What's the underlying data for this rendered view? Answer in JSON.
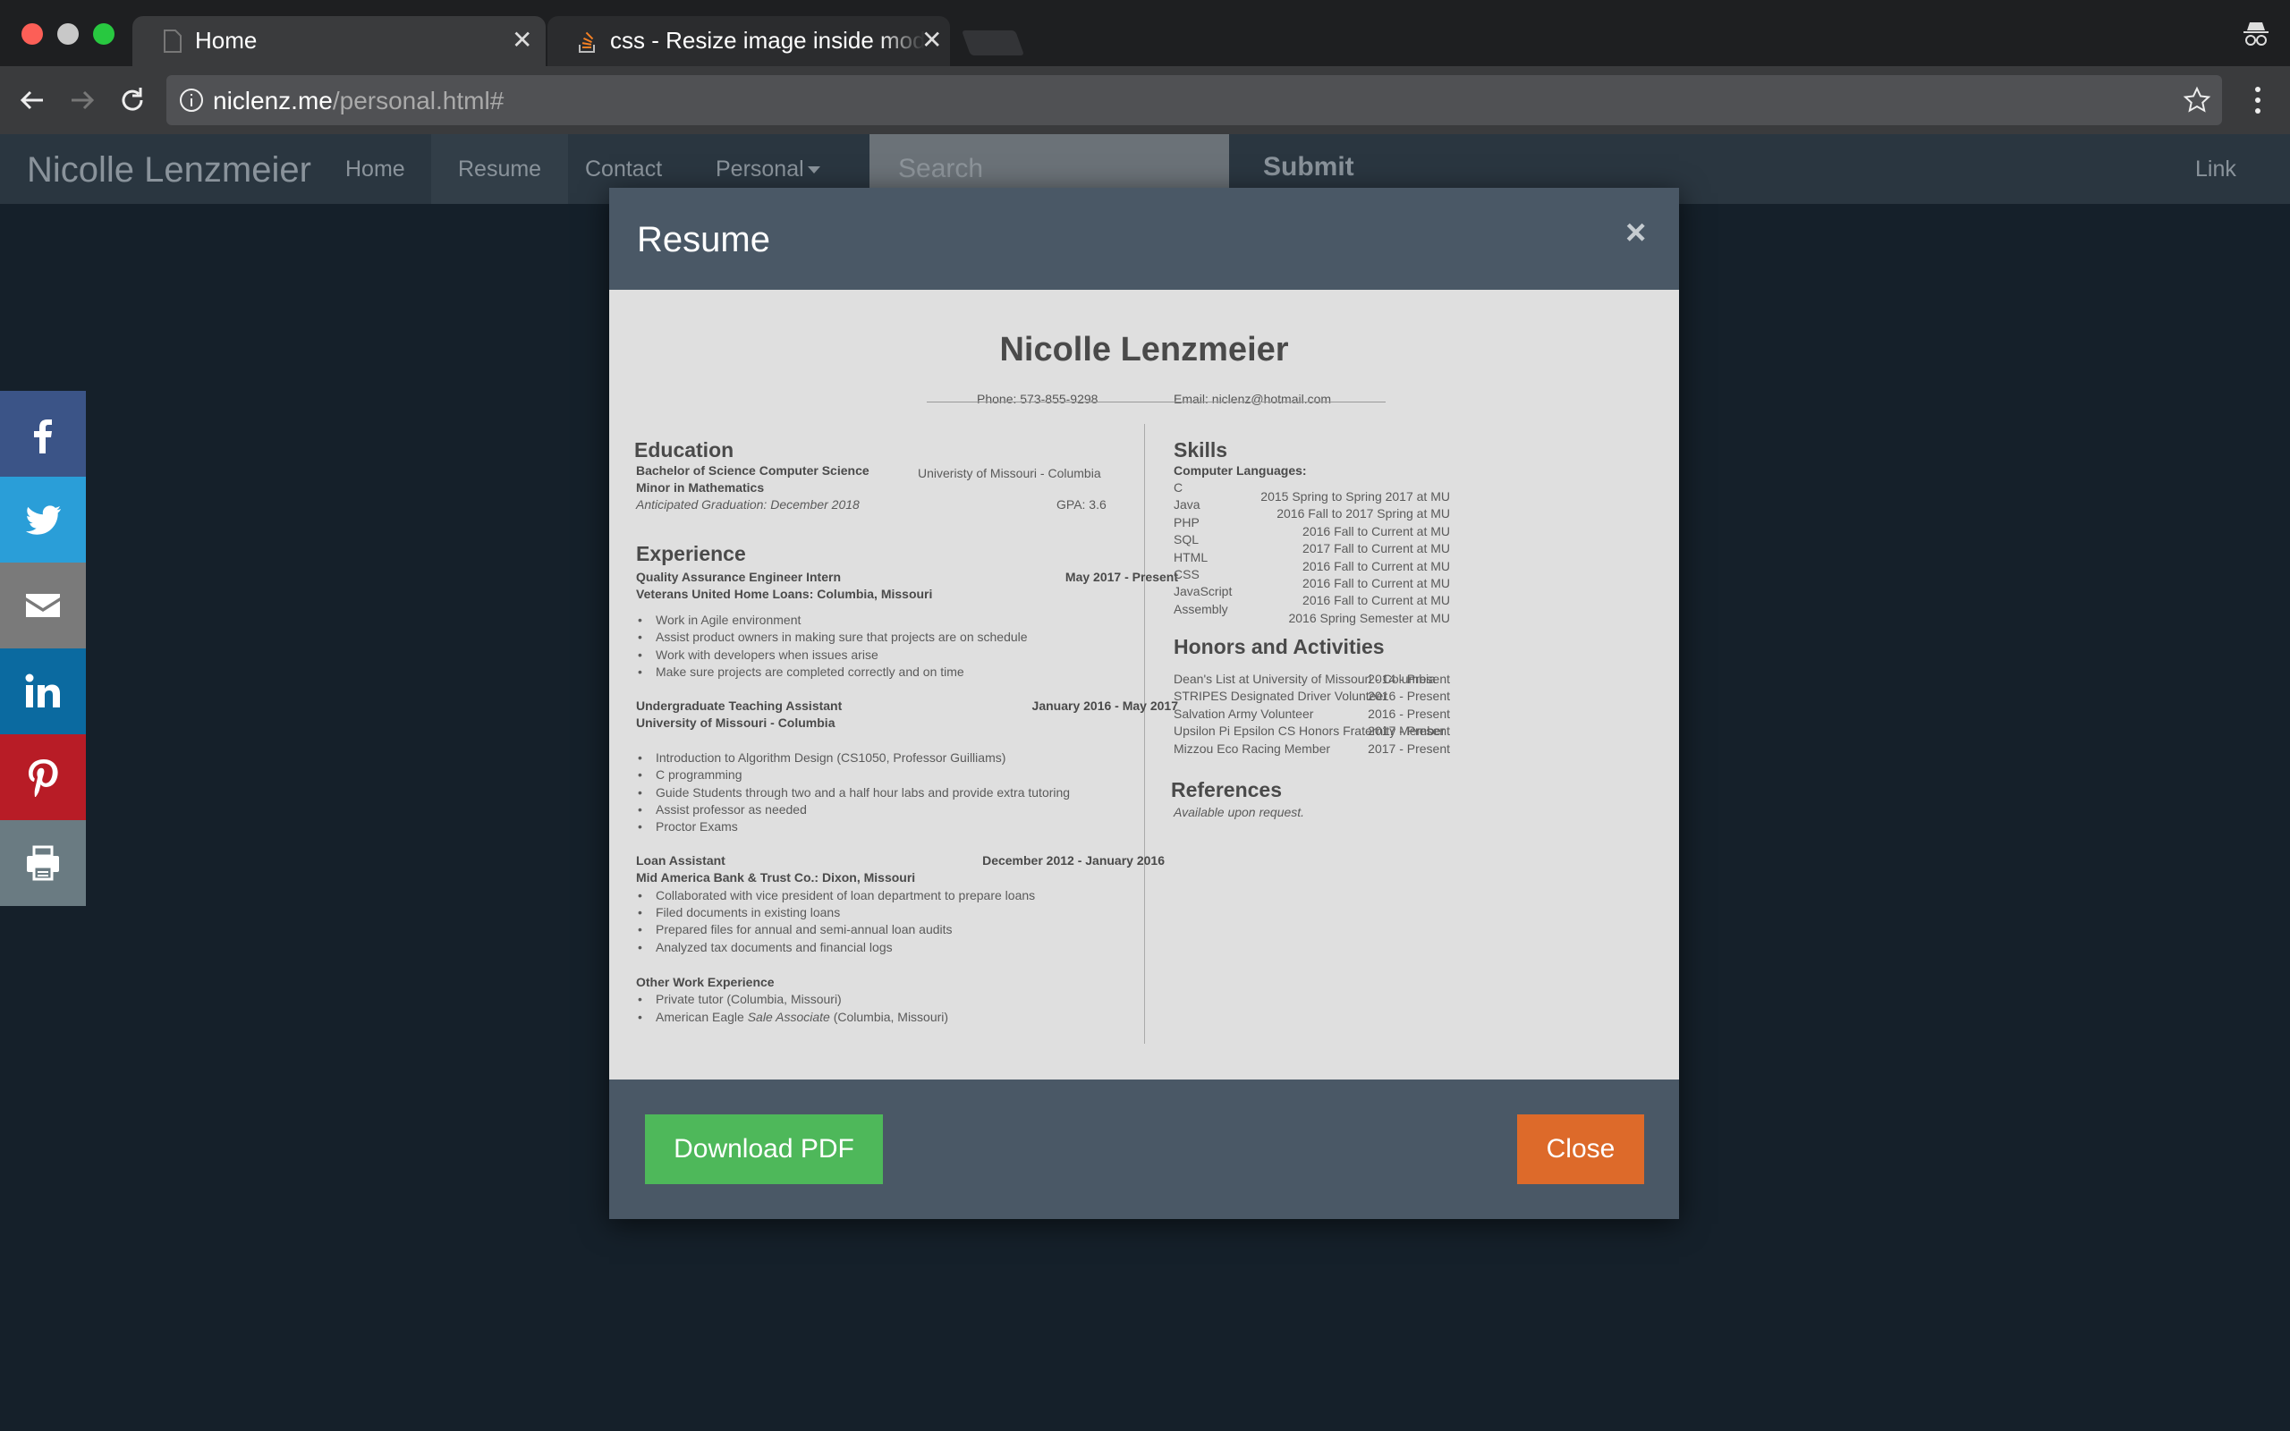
{
  "browser": {
    "tabs": [
      {
        "title": "Home",
        "active": true
      },
      {
        "title": "css - Resize image inside modal",
        "active": false
      }
    ],
    "url_host": "niclenz.me",
    "url_path": "/personal.html#"
  },
  "navbar": {
    "brand": "Nicolle Lenzmeier",
    "links": [
      "Home",
      "Resume",
      "Contact",
      "Personal"
    ],
    "active_link": "Resume",
    "search_placeholder": "Search",
    "submit_label": "Submit",
    "right_link": "Link"
  },
  "share": [
    "facebook-icon",
    "twitter-icon",
    "email-icon",
    "linkedin-icon",
    "pinterest-icon",
    "print-icon"
  ],
  "modal": {
    "title": "Resume",
    "close_x": "×",
    "download_label": "Download PDF",
    "close_label": "Close"
  },
  "resume": {
    "name": "Nicolle Lenzmeier",
    "phone": "Phone: 573-855-9298",
    "email": "Email: niclenz@hotmail.com",
    "education": {
      "heading": "Education",
      "degree": "Bachelor of Science Computer Science",
      "minor": "Minor in Mathematics",
      "school": "Univeristy of Missouri - Columbia",
      "graduation": "Anticipated Graduation: December 2018",
      "gpa": "GPA: 3.6"
    },
    "experience": {
      "heading": "Experience",
      "jobs": [
        {
          "title": "Quality Assurance Engineer Intern",
          "dates": "May 2017 - Present",
          "company": "Veterans United Home Loans: Columbia, Missouri",
          "bullets": [
            "Work in Agile environment",
            "Assist product owners in making sure that projects are on schedule",
            "Work with developers when issues arise",
            "Make sure projects are completed correctly and on time"
          ]
        },
        {
          "title": "Undergraduate Teaching Assistant",
          "dates": "January 2016 - May 2017",
          "company": "University of Missouri - Columbia",
          "bullets": [
            "Introduction to Algorithm Design (CS1050, Professor Guilliams)",
            "C programming",
            "Guide Students through two and a half hour labs and provide extra tutoring",
            "Assist professor as needed",
            "Proctor Exams"
          ]
        },
        {
          "title": "Loan Assistant",
          "dates": "December 2012 - January 2016",
          "company": "Mid America Bank & Trust Co.: Dixon, Missouri",
          "bullets": [
            "Collaborated with vice president of loan department to prepare loans",
            "Filed documents in existing loans",
            "Prepared files for annual and semi-annual loan audits",
            "Analyzed tax documents and financial logs"
          ]
        }
      ],
      "other_heading": "Other Work Experience",
      "other": [
        "Private tutor (Columbia, Missouri)",
        "American Eagle",
        "Sale Associate",
        "(Columbia, Missouri)"
      ]
    },
    "skills": {
      "heading": "Skills",
      "sub": "Computer Languages:",
      "items": [
        {
          "lang": "C",
          "when": "2015 Spring to Spring 2017 at MU"
        },
        {
          "lang": "Java",
          "when": "2016 Fall to 2017 Spring at MU"
        },
        {
          "lang": "PHP",
          "when": "2016 Fall to Current at MU"
        },
        {
          "lang": "SQL",
          "when": "2017 Fall to Current at MU"
        },
        {
          "lang": "HTML",
          "when": "2016 Fall to Current at MU"
        },
        {
          "lang": "CSS",
          "when": "2016 Fall to Current at MU"
        },
        {
          "lang": "JavaScript",
          "when": "2016 Fall to Current at MU"
        },
        {
          "lang": "Assembly",
          "when": "2016 Spring Semester at MU"
        }
      ]
    },
    "honors": {
      "heading": "Honors and Activities",
      "items": [
        {
          "name": "Dean's List at University of Missouri - Columbia",
          "when": "2014 - Present"
        },
        {
          "name": "STRIPES Designated Driver Volunteer",
          "when": "2016 - Present"
        },
        {
          "name": "Salvation Army Volunteer",
          "when": "2016 - Present"
        },
        {
          "name": "Upsilon Pi Epsilon CS Honors Fraternity Member",
          "when": "2017 - Present"
        },
        {
          "name": "Mizzou Eco Racing Member",
          "when": "2017 - Present"
        }
      ]
    },
    "references": {
      "heading": "References",
      "text": "Available upon request."
    }
  }
}
